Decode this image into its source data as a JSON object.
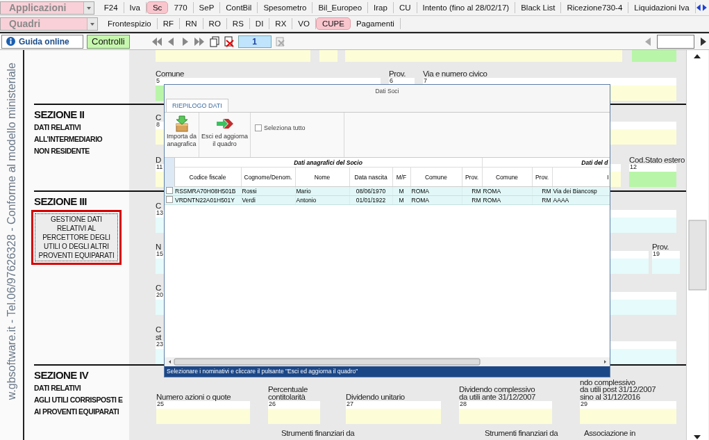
{
  "app_menu": {
    "applicazioni": "Applicazioni",
    "quadri": "Quadri"
  },
  "module_tabs": [
    {
      "label": "F24",
      "selected": false
    },
    {
      "label": "Iva",
      "selected": false
    },
    {
      "label": "Sc",
      "selected": true
    },
    {
      "label": "770",
      "selected": false
    },
    {
      "label": "SeP",
      "selected": false
    },
    {
      "label": "ContBil",
      "selected": false
    },
    {
      "label": "Spesometro",
      "selected": false
    },
    {
      "label": "Bil_Europeo",
      "selected": false
    },
    {
      "label": "Irap",
      "selected": false
    },
    {
      "label": "CU",
      "selected": false
    },
    {
      "label": "Intento (fino al 28/02/17)",
      "selected": false
    },
    {
      "label": "Black List",
      "selected": false
    },
    {
      "label": "Ricezione730-4",
      "selected": false
    },
    {
      "label": "Liquidazioni Iva",
      "selected": false
    }
  ],
  "section_tabs": [
    {
      "label": "Frontespizio",
      "selected": false
    },
    {
      "label": "RF",
      "selected": false
    },
    {
      "label": "RN",
      "selected": false
    },
    {
      "label": "RO",
      "selected": false
    },
    {
      "label": "RS",
      "selected": false
    },
    {
      "label": "DI",
      "selected": false
    },
    {
      "label": "RX",
      "selected": false
    },
    {
      "label": "VO",
      "selected": false
    },
    {
      "label": "CUPE",
      "selected": true
    },
    {
      "label": "Pagamenti",
      "selected": false
    }
  ],
  "toolbar": {
    "help": "Guida online",
    "checks": "Controlli",
    "page": "1"
  },
  "side_text": "w.gbsoftware.it - Tel.06/97626328 - Conforme al modello ministeriale",
  "sections": [
    {
      "bands": [
        [
          {
            "color": "#fdfdd8"
          },
          {
            "color": "#fdfdd8"
          },
          {
            "color": "#fdfdd8"
          },
          {
            "color": "#b8f5a8"
          }
        ],
        [
          {
            "label": "Comune",
            "number": "5",
            "color": "#b8f5a8"
          },
          {
            "label": "Prov.",
            "number": "6"
          },
          {
            "label": "Via e numero civico",
            "number": "7",
            "color": "#fdfdd8"
          }
        ]
      ]
    },
    {
      "title": "SEZIONE II",
      "subtitle": "DATI RELATIVI\nALL’INTERMEDIARIO\nNON RESIDENTE",
      "bands": [
        [
          {
            "label": "C",
            "number": "8",
            "color": "#fdfdd8"
          }
        ],
        [
          {
            "label": "D",
            "number": "11",
            "color": "#fdfdd8"
          },
          {
            "label": "Cod.Stato estero",
            "number": "12",
            "color": "#b8f5a8"
          }
        ]
      ]
    },
    {
      "title": "SEZIONE III",
      "button": "GESTIONE DATI\nRELATIVI AL\nPERCETTORE DEGLI\nUTILI O DEGLI ALTRI\nPROVENTI EQUIPARATI",
      "bands": [
        [
          {
            "label": "C",
            "number": "13",
            "color": "#e6fbfb"
          }
        ],
        [
          {
            "label": "N",
            "number": "15",
            "color": "#e6fbfb"
          },
          {
            "label": "Prov.",
            "number": "19",
            "color": "#e6fbfb"
          }
        ],
        [
          {
            "label": "C",
            "number": "20",
            "color": "#e6fbfb"
          }
        ],
        [
          {
            "label": "C\nst",
            "number": "23",
            "color": "#e6fbfb"
          }
        ]
      ]
    },
    {
      "title": "SEZIONE IV",
      "subtitle": "DATI RELATIVI\nAGLI UTILI CORRISPOSTI E\nAI PROVENTI EQUIPARATI",
      "bands": [
        [
          {
            "label": "Numero azioni o quote",
            "number": "25",
            "color": "#fdfdd8"
          },
          {
            "label": "Percentuale\ncontitolarità",
            "number": "26",
            "color": "#fdfdd8"
          },
          {
            "label": "Dividendo unitario",
            "number": "27",
            "color": "#fdfdd8"
          },
          {
            "label": "Dividendo complessivo\nda utili ante 31/12/2007",
            "number": "28",
            "color": "#fdfdd8"
          },
          {
            "label": "ndo complessivo\nda utili post 31/12/2007\nsino al 31/12/2016",
            "number": "29",
            "color": "#fdfdd8"
          }
        ],
        [
          {
            "label": "Strumenti finanziari da"
          },
          {
            "label": "Strumenti finanziari da"
          },
          {
            "label": "Associazione in"
          }
        ]
      ]
    }
  ],
  "dialog": {
    "title": "Dati Soci",
    "tabs": [
      {
        "label": "RIEPILOGO DATI",
        "selected": true
      }
    ],
    "actions": [
      {
        "kind": "import",
        "label": "Importa da\nanagrafica"
      },
      {
        "kind": "exit",
        "label": "Esci ed aggiorna\nil quadro"
      }
    ],
    "select_all": {
      "label": "Seleziona tutto",
      "checked": false
    },
    "groups": [
      "Dati anagrafici del Socio",
      "Dati del d"
    ],
    "columns": [
      "Codice fiscale",
      "Cognome/Denom.",
      "Nome",
      "Data nascita",
      "M/F",
      "Comune",
      "Prov.",
      "Comune",
      "Prov.",
      "I"
    ],
    "rows": [
      {
        "checked": false,
        "cells": [
          "RSSMRA70H08H501B",
          "Rossi",
          "Mario",
          "08/06/1970",
          "M",
          "ROMA",
          "RM",
          "ROMA",
          "RM",
          "Via dei Biancosp"
        ]
      },
      {
        "checked": false,
        "cells": [
          "VRDNTN22A01H501Y",
          "Verdi",
          "Antonio",
          "01/01/1922",
          "M",
          "ROMA",
          "RM",
          "ROMA",
          "RM",
          "AAAA"
        ]
      }
    ],
    "status": "Selezionare i nominativi e cliccare il pulsante \"Esci ed aggiorna il quadro\""
  }
}
